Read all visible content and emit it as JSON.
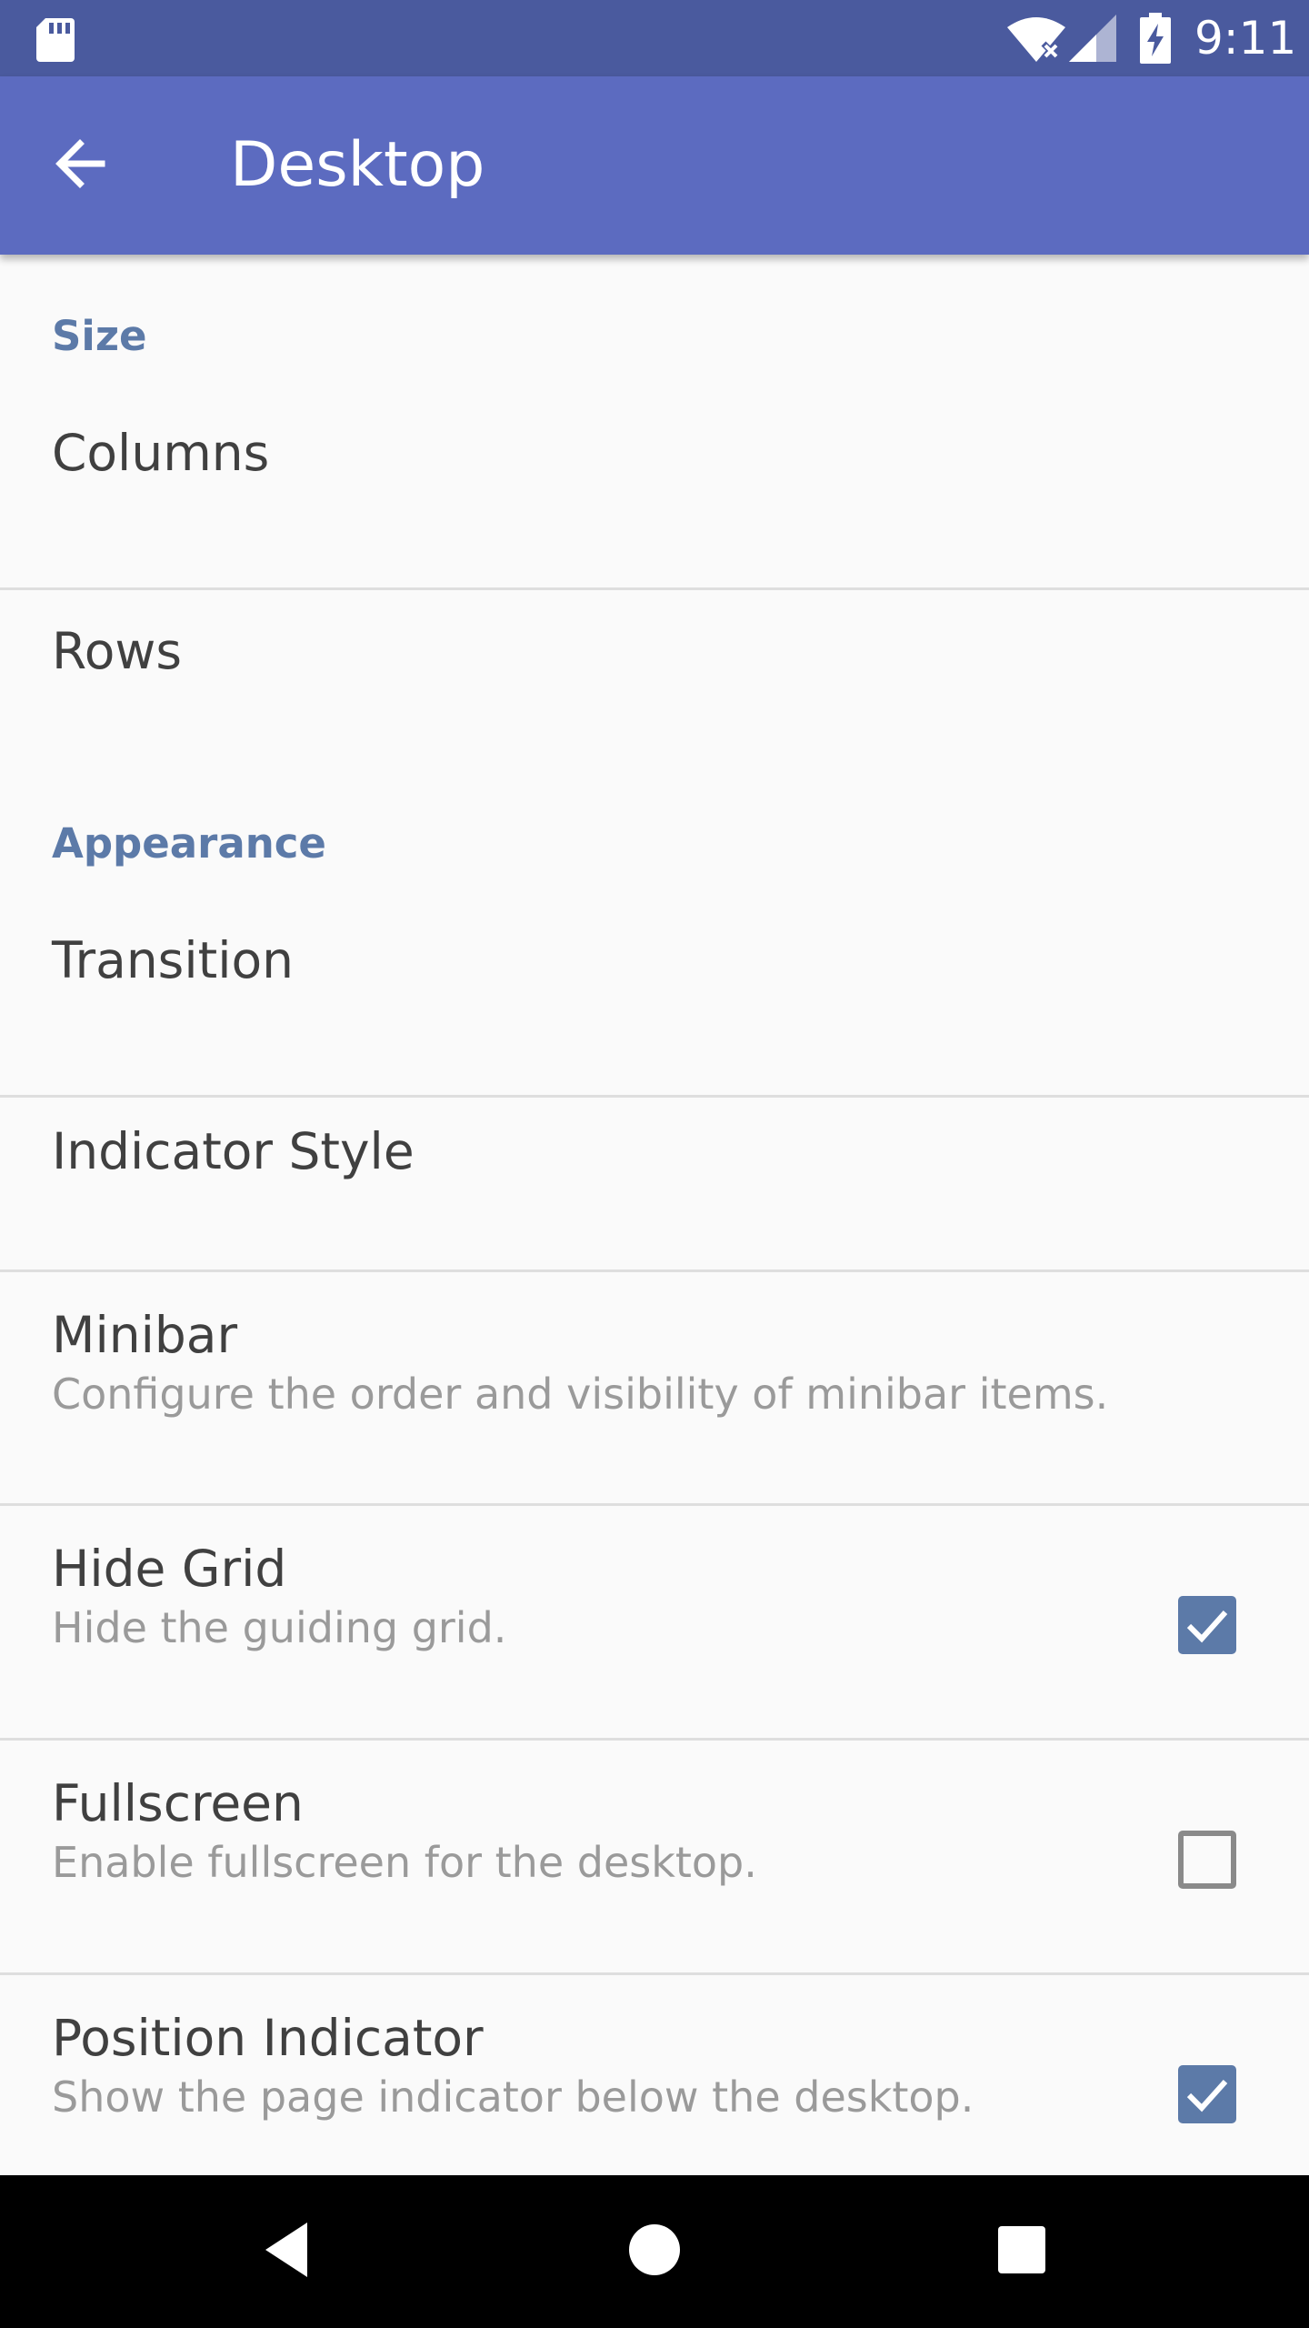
{
  "status_bar": {
    "time": "9:11",
    "icons": [
      "sd-card-icon",
      "wifi-icon",
      "cell-signal-icon",
      "battery-charging-icon"
    ]
  },
  "app_bar": {
    "title": "Desktop",
    "back_icon": "arrow-back-icon"
  },
  "sections": [
    {
      "header": "Size",
      "items": [
        {
          "title": "Columns"
        },
        {
          "title": "Rows"
        }
      ]
    },
    {
      "header": "Appearance",
      "items": [
        {
          "title": "Transition"
        },
        {
          "title": "Indicator Style"
        },
        {
          "title": "Minibar",
          "summary": "Configure the order and visibility of minibar items."
        },
        {
          "title": "Hide Grid",
          "summary": "Hide the guiding grid.",
          "checked": true
        },
        {
          "title": "Fullscreen",
          "summary": "Enable fullscreen for the desktop.",
          "checked": false
        },
        {
          "title": "Position Indicator",
          "summary": "Show the page indicator below the desktop.",
          "checked": true
        }
      ]
    }
  ],
  "nav_bar": {
    "icons": [
      "back-triangle-icon",
      "home-circle-icon",
      "recents-square-icon"
    ]
  },
  "colors": {
    "status_bar": "#4a5a9e",
    "app_bar": "#5c6bc0",
    "accent": "#5c7aa8",
    "background": "#fafafa"
  }
}
